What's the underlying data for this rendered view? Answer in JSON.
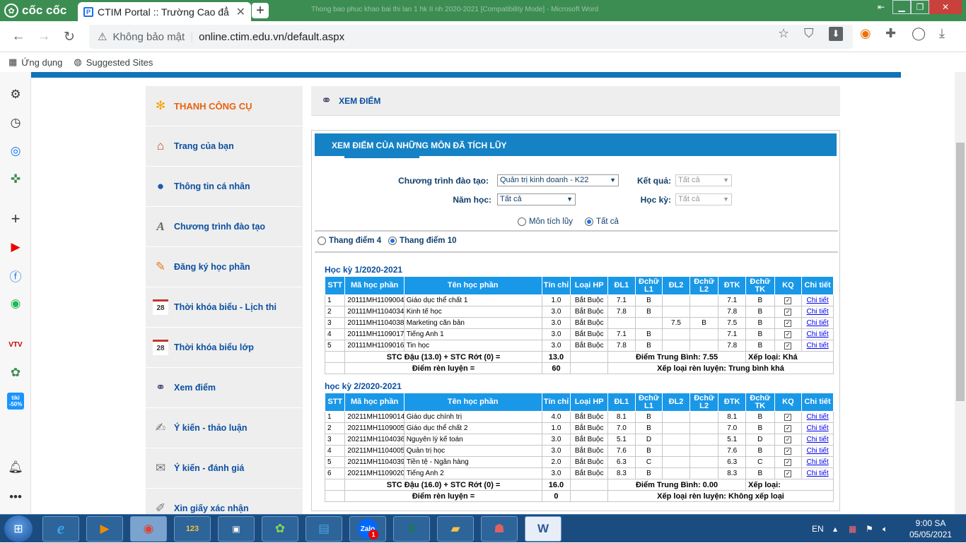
{
  "browser": {
    "brand": "cốc cốc",
    "tab_title": "CTIM Portal :: Trường Cao đẳ",
    "window_title": "Thong bao phuc khao bai thi lan 1 hk II nh 2020-2021 [Compatibility Mode] - Microsoft Word",
    "security_label": "Không bảo mật",
    "url": "online.ctim.edu.vn/default.aspx",
    "bookmarks": [
      "Ứng dụng",
      "Suggested Sites"
    ]
  },
  "menu": {
    "header": "THANH CÔNG CỤ",
    "items": [
      "Trang của bạn",
      "Thông tin cá nhân",
      "Chương trình đào tạo",
      "Đăng ký học phần",
      "Thời khóa biểu - Lịch thi",
      "Thời khóa biểu lớp",
      "Xem điểm",
      "Ý kiến - thảo luận",
      "Ý kiến - đánh giá",
      "Xin giấy xác nhận"
    ]
  },
  "page_header": "XEM ĐIỂM",
  "panel": {
    "title": "XEM ĐIỂM CỦA NHỮNG MÔN ĐÃ TÍCH LŨY",
    "filters": {
      "program_label": "Chương trình đào tạo:",
      "program_value": "Quản trị kinh doanh - K22",
      "result_label": "Kết quả:",
      "result_value": "Tất cả",
      "year_label": "Năm học:",
      "year_value": "Tất cả",
      "semester_label": "Học kỳ:",
      "semester_value": "Tất cả",
      "radio_accum": "Môn tích lũy",
      "radio_all": "Tất cả"
    },
    "scale": {
      "four": "Thang điểm 4",
      "ten": "Thang điểm 10"
    }
  },
  "columns": [
    "STT",
    "Mã học phần",
    "Tên học phần",
    "Tín chỉ",
    "Loại HP",
    "ĐL1",
    "Đchữ L1",
    "ĐL2",
    "Đchữ L2",
    "ĐTK",
    "Đchữ TK",
    "KQ",
    "Chi tiết"
  ],
  "semesters": [
    {
      "title": "Học kỳ 1/2020-2021",
      "rows": [
        [
          "1",
          "20111MH1109004",
          "Giáo dục thể chất 1",
          "1.0",
          "Bắt Buộc",
          "7.1",
          "B",
          "",
          "",
          "7.1",
          "B"
        ],
        [
          "2",
          "20111MH1104034",
          "Kinh tế học",
          "3.0",
          "Bắt Buộc",
          "7.8",
          "B",
          "",
          "",
          "7.8",
          "B"
        ],
        [
          "3",
          "20111MH1104038",
          "Marketing căn bản",
          "3.0",
          "Bắt Buộc",
          "",
          "",
          "7.5",
          "B",
          "7.5",
          "B"
        ],
        [
          "4",
          "20111MH1109017",
          "Tiếng Anh 1",
          "3.0",
          "Bắt Buộc",
          "7.1",
          "B",
          "",
          "",
          "7.1",
          "B"
        ],
        [
          "5",
          "20111MH1109016",
          "Tin học",
          "3.0",
          "Bắt Buộc",
          "7.8",
          "B",
          "",
          "",
          "7.8",
          "B"
        ]
      ],
      "credits_label": "STC Đậu (13.0) + STC Rớt (0) =",
      "credits_value": "13.0",
      "avg_label": "Điểm Trung Bình: 7.55",
      "rank_label": "Xếp loại: Khá",
      "conduct_label": "Điểm rèn luyện =",
      "conduct_value": "60",
      "conduct_rank": "Xếp loại rèn luyện: Trung bình khá"
    },
    {
      "title": "học kỳ 2/2020-2021",
      "rows": [
        [
          "1",
          "20211MH1109014",
          "Giáo dục chính trị",
          "4.0",
          "Bắt Buộc",
          "8.1",
          "B",
          "",
          "",
          "8.1",
          "B"
        ],
        [
          "2",
          "20211MH1109005",
          "Giáo dục thể chất 2",
          "1.0",
          "Bắt Buộc",
          "7.0",
          "B",
          "",
          "",
          "7.0",
          "B"
        ],
        [
          "3",
          "20211MH1104036",
          "Nguyên lý kế toán",
          "3.0",
          "Bắt Buộc",
          "5.1",
          "D",
          "",
          "",
          "5.1",
          "D"
        ],
        [
          "4",
          "20211MH1104005",
          "Quản trị học",
          "3.0",
          "Bắt Buộc",
          "7.6",
          "B",
          "",
          "",
          "7.6",
          "B"
        ],
        [
          "5",
          "20211MH1104039",
          "Tiền tệ - Ngân hàng",
          "2.0",
          "Bắt Buộc",
          "6.3",
          "C",
          "",
          "",
          "6.3",
          "C"
        ],
        [
          "6",
          "20211MH1109020",
          "Tiếng Anh 2",
          "3.0",
          "Bắt Buộc",
          "8.3",
          "B",
          "",
          "",
          "8.3",
          "B"
        ]
      ],
      "credits_label": "STC Đậu (16.0) + STC Rớt (0) =",
      "credits_value": "16.0",
      "avg_label": "Điểm Trung Bình: 0.00",
      "rank_label": "Xếp loại:",
      "conduct_label": "Điểm rèn luyện =",
      "conduct_value": "0",
      "conduct_rank": "Xếp loại rèn luyện: Không xếp loại"
    }
  ],
  "detail_link": "Chi tiết",
  "taskbar": {
    "lang": "EN",
    "time": "9:00 SA",
    "date": "05/05/2021",
    "zalo_badge": "1",
    "tiki_badge": "tiki -50%"
  }
}
